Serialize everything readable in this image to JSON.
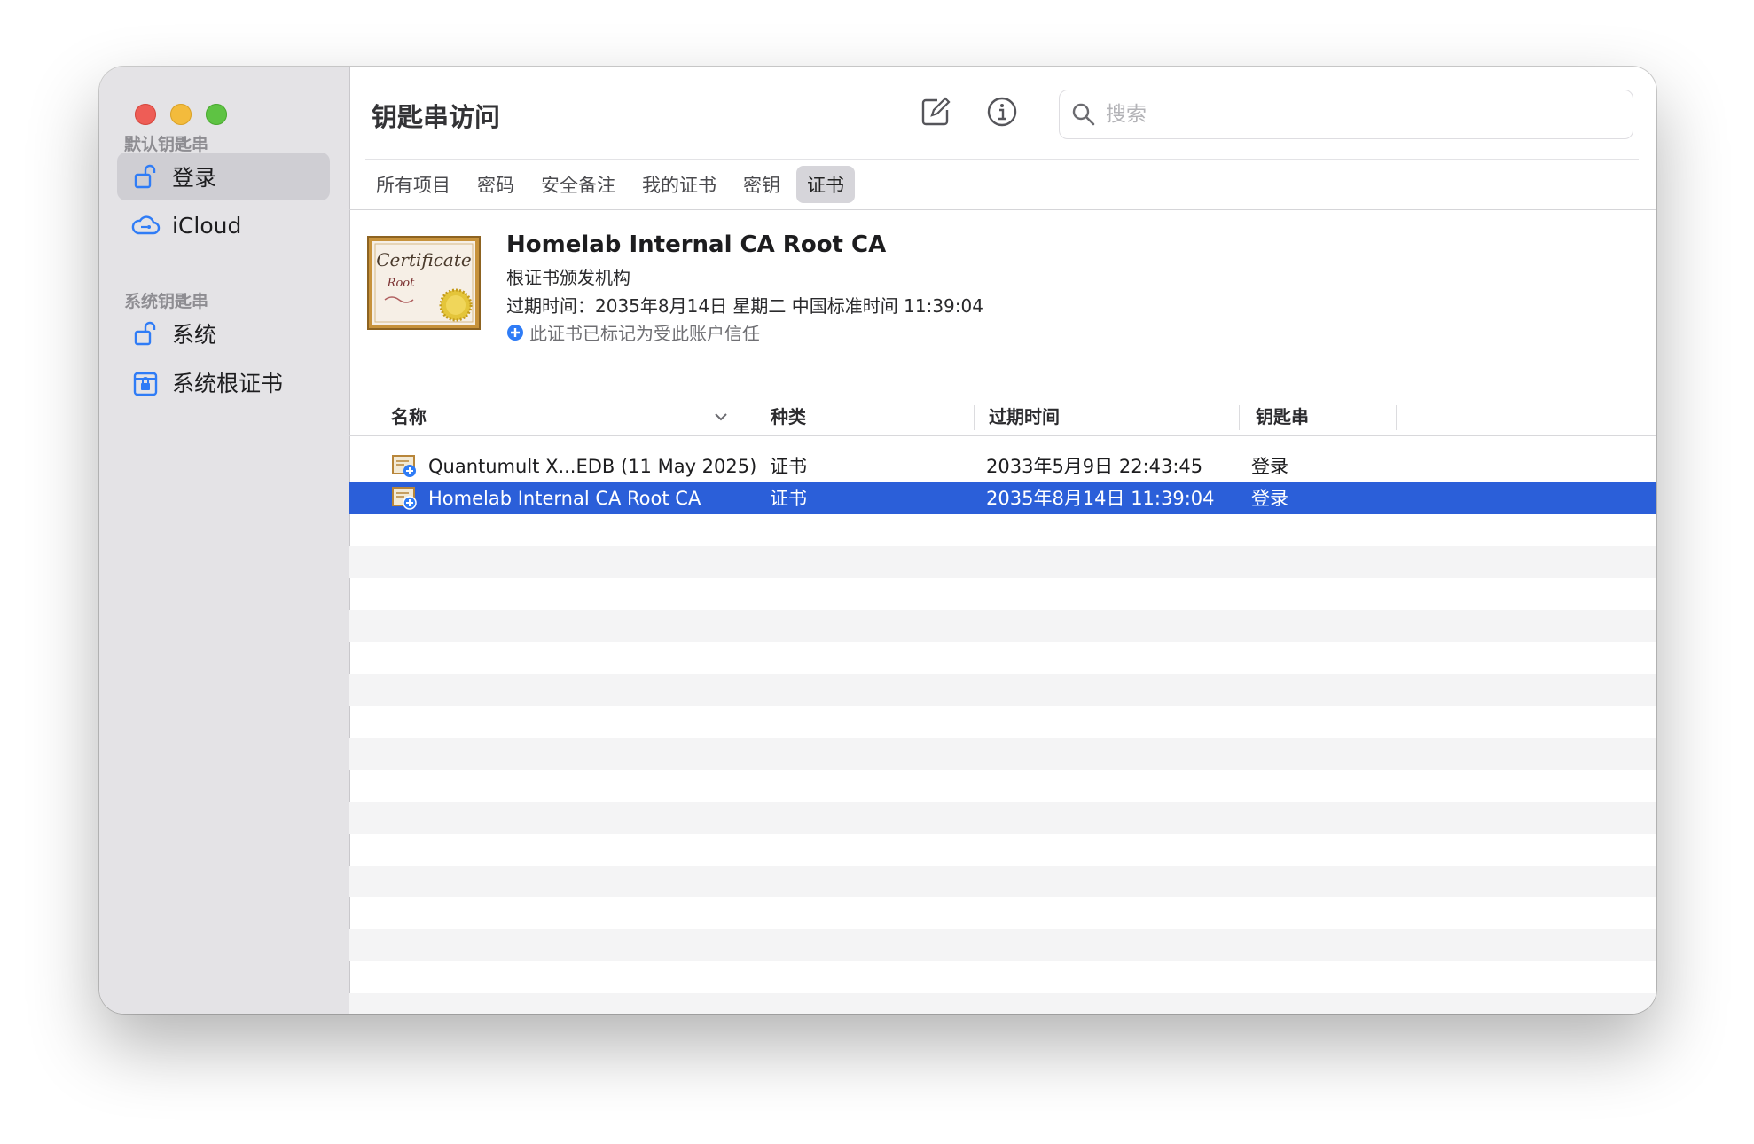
{
  "window": {
    "title": "钥匙串访问",
    "traffic_lights": {
      "close": "#ee5d56",
      "minimize": "#f3bb3c",
      "zoom": "#5ec343"
    }
  },
  "sidebar": {
    "sections": [
      {
        "title": "默认钥匙串",
        "items": [
          {
            "label": "登录",
            "icon": "unlocked-padlock-icon",
            "selected": true
          },
          {
            "label": "iCloud",
            "icon": "icloud-icon",
            "selected": false
          }
        ]
      },
      {
        "title": "系统钥匙串",
        "items": [
          {
            "label": "系统",
            "icon": "unlocked-padlock-icon",
            "selected": false
          },
          {
            "label": "系统根证书",
            "icon": "locked-cabinet-icon",
            "selected": false
          }
        ]
      }
    ]
  },
  "toolbar": {
    "new_item_icon": "compose-icon",
    "info_icon": "info-icon",
    "search": {
      "placeholder": "搜索",
      "value": "",
      "icon": "search-icon"
    }
  },
  "tabs": [
    {
      "label": "所有项目",
      "active": false
    },
    {
      "label": "密码",
      "active": false
    },
    {
      "label": "安全备注",
      "active": false
    },
    {
      "label": "我的证书",
      "active": false
    },
    {
      "label": "密钥",
      "active": false
    },
    {
      "label": "证书",
      "active": true
    }
  ],
  "detail": {
    "name": "Homelab Internal CA Root CA",
    "kind": "根证书颁发机构",
    "expires": "过期时间：2035年8月14日 星期二 中国标准时间 11:39:04",
    "trust": "此证书已标记为受此账户信任",
    "certificate_image_text": {
      "line1": "Certificate",
      "line2": "Root"
    }
  },
  "table": {
    "columns": [
      "名称",
      "种类",
      "过期时间",
      "钥匙串"
    ],
    "sort_indicator": "chevron-down-icon",
    "rows": [
      {
        "name": "Quantumult X...EDB (11 May 2025)",
        "kind": "证书",
        "expires": "2033年5月9日 22:43:45",
        "keychain": "登录",
        "selected": false
      },
      {
        "name": "Homelab Internal CA Root CA",
        "kind": "证书",
        "expires": "2035年8月14日 11:39:04",
        "keychain": "登录",
        "selected": true
      }
    ]
  },
  "colors": {
    "selection": "#2b5fd9",
    "sidebar_bg": "#e4e3e6",
    "accent_icon": "#2f7cf6"
  }
}
